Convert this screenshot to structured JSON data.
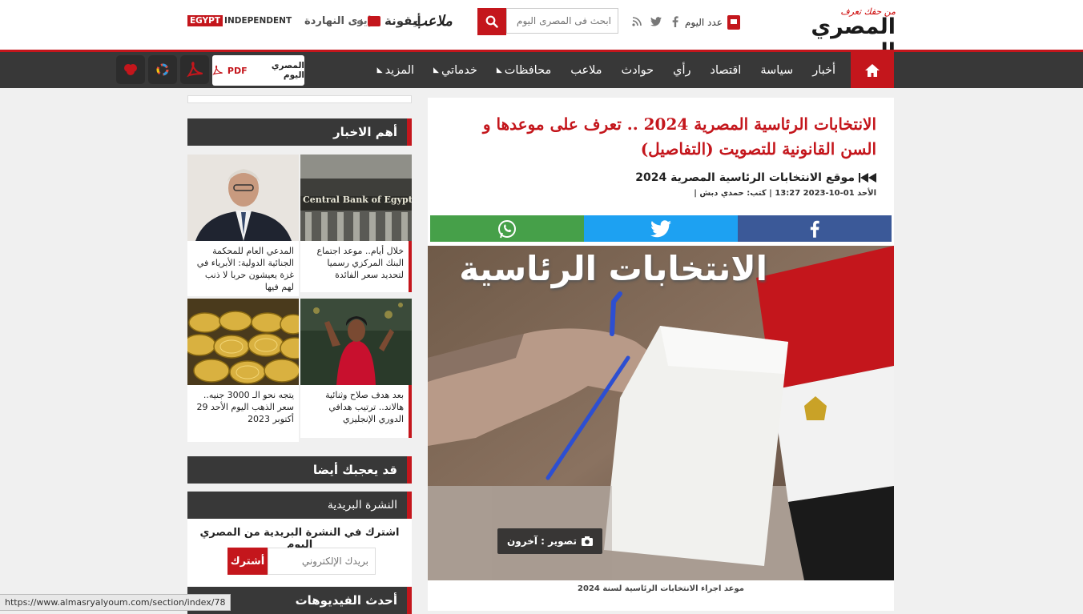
{
  "header": {
    "logo_tagline": "من حقك تعرف",
    "logo_name": "المصري اليوم",
    "issue_label": "عدد اليوم",
    "search_placeholder": "ابحث فى المصرى اليوم",
    "sister_sites": {
      "mal3ab": "ملاعب",
      "almasry_x": "أيقونة",
      "aih": "إيه",
      "zay": "زى النهاردة",
      "egypt": "EGYPT",
      "independent": "INDEPENDENT"
    }
  },
  "nav": {
    "items": [
      {
        "label": "أخبار",
        "dropdown": false
      },
      {
        "label": "سياسة",
        "dropdown": false
      },
      {
        "label": "اقتصاد",
        "dropdown": false
      },
      {
        "label": "رأي",
        "dropdown": false
      },
      {
        "label": "حوادث",
        "dropdown": false
      },
      {
        "label": "ملاعب",
        "dropdown": false
      },
      {
        "label": "محافظات",
        "dropdown": true
      },
      {
        "label": "خدماتي",
        "dropdown": true
      },
      {
        "label": "المزيد",
        "dropdown": true
      }
    ],
    "pdf_label": "المصري اليوم",
    "pdf_tag": "PDF"
  },
  "sidebar": {
    "top_news_title": "أهم الاخبار",
    "cards": [
      {
        "text": "خلال أيام.. موعد اجتماع البنك المركزي رسميا لتحديد سعر الفائدة",
        "img_caption": "Central Bank of Egypt"
      },
      {
        "text": "المدعي العام للمحكمة الجنائية الدولية: الأبرياء في غزة يعيشون حربا لا ذنب لهم فيها"
      },
      {
        "text": "بعد هدف صلاح وثنائية هالاند.. ترتيب هدافي الدوري الإنجليزي"
      },
      {
        "text": "يتجه نحو الـ 3000 جنيه.. سعر الذهب اليوم الأحد 29 أكتوبر 2023"
      }
    ],
    "might_like_title": "قد يعجبك أيضا",
    "newsletter": {
      "heading": "النشرة البريدية",
      "title": "اشترك في النشرة البريدية من المصري اليوم",
      "email_placeholder": "بريدك الإلكتروني",
      "subscribe_label": "أشترك"
    },
    "videos_title": "أحدث الفيديوهات"
  },
  "article": {
    "title": "الانتخابات الرئاسية المصرية 2024 .. تعرف على موعدها و السن القانونية للتصويت (التفاصيل)",
    "subtitle": "موقع الانتخابات الرئاسية المصرية 2024",
    "meta": "الأحد 01-10-2023 13:27 | كتب: حمدي دبش |",
    "image_text": "الانتخابات الرئاسية",
    "photo_credit": "تصوير : آخرون",
    "caption": "موعد اجراء الانتخابات الرئاسية لسنة 2024"
  },
  "status_bar": {
    "url": "https://www.almasryalyoum.com/section/index/78"
  }
}
